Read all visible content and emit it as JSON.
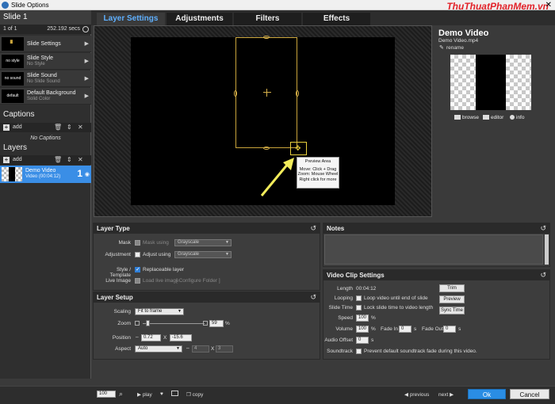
{
  "window": {
    "title": "Slide Options",
    "watermark": "ThuThuatPhanMem.vn"
  },
  "slide": {
    "name": "Slide 1",
    "position": "1 of 1",
    "duration": "252.192 secs"
  },
  "slide_options": [
    {
      "label": "Slide Settings",
      "sub": "",
      "thumb": ""
    },
    {
      "label": "Slide Style",
      "sub": "No Style",
      "thumb": "no style"
    },
    {
      "label": "Slide Sound",
      "sub": "No Slide Sound",
      "thumb": "no sound"
    },
    {
      "label": "Default Background",
      "sub": "Solid Color",
      "thumb": "default"
    }
  ],
  "captions": {
    "header": "Captions",
    "add_label": "add",
    "empty": "No Captions"
  },
  "layers": {
    "header": "Layers",
    "add_label": "add",
    "items": [
      {
        "name": "Demo Video",
        "detail": "Video (00:04:12)",
        "number": "1"
      }
    ]
  },
  "tabs": [
    "Layer Settings",
    "Adjustments",
    "Filters",
    "Effects"
  ],
  "preview": {
    "tooltip_title": "Preview Area",
    "tooltip_lines": [
      "Move: Click + Drag",
      "Zoom: Mouse Wheel",
      "Right click for more"
    ]
  },
  "media": {
    "title": "Demo Video",
    "file": "Demo Video.mp4",
    "rename": "rename",
    "browse": "browse",
    "editor": "editor",
    "info": "info"
  },
  "layer_type": {
    "header": "Layer Type",
    "mask_label": "Mask",
    "mask_using": "Mask using",
    "mask_value": "Grayscale",
    "adjustment_label": "Adjustment",
    "adjust_using": "Adjust using",
    "adjust_value": "Grayscale",
    "style_label": "Style / Template",
    "replaceable": "Replaceable layer",
    "live_label": "Live Image",
    "load_live": "Load live image",
    "configure": "[ Configure Folder ]"
  },
  "layer_setup": {
    "header": "Layer Setup",
    "scaling_label": "Scaling",
    "scaling_value": "Fit to frame",
    "zoom_label": "Zoom",
    "zoom_value": "59",
    "zoom_unit": "%",
    "position_label": "Position",
    "pos_x": "0.72",
    "pos_sep": "X",
    "pos_y": "-15.6",
    "aspect_label": "Aspect",
    "aspect_value": "Auto",
    "aspect_w": "4",
    "aspect_sep": "X",
    "aspect_h": "3"
  },
  "notes": {
    "header": "Notes"
  },
  "video_clip": {
    "header": "Video Clip Settings",
    "length_label": "Length",
    "length_value": "00:04:12",
    "looping_label": "Looping",
    "looping_text": "Loop video until end of slide",
    "slidetime_label": "Slide Time",
    "slidetime_text": "Lock slide time to video length",
    "speed_label": "Speed",
    "speed_value": "100",
    "speed_unit": "%",
    "volume_label": "Volume",
    "volume_value": "100",
    "volume_unit": "%",
    "fadein_label": "Fade In",
    "fadein_value": "0",
    "fadein_unit": "s",
    "fadeout_label": "Fade Out",
    "fadeout_value": "0",
    "fadeout_unit": "s",
    "audio_label": "Audio Offset",
    "audio_value": "0",
    "audio_unit": "s",
    "soundtrack_label": "Soundtrack",
    "soundtrack_text": "Prevent default soundtrack fade during this video.",
    "trim": "Trim",
    "preview": "Preview",
    "sync": "Sync Time"
  },
  "bottom": {
    "zoom": "100",
    "play": "play",
    "copy": "copy",
    "previous": "previous",
    "next": "next",
    "ok": "Ok",
    "cancel": "Cancel"
  }
}
